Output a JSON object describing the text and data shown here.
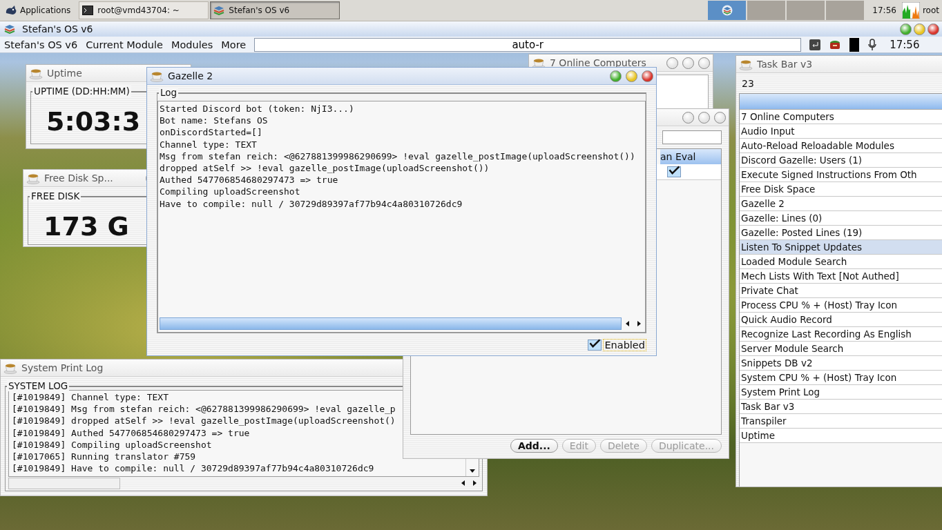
{
  "top_panel": {
    "apps_menu": "Applications",
    "tasks": [
      {
        "label": "root@vmd43704: ~",
        "kind": "terminal",
        "selected": false
      },
      {
        "label": "Stefan's OS v6",
        "kind": "app",
        "selected": true
      }
    ],
    "workspaces": [
      {
        "selected": true
      },
      {
        "selected": false
      },
      {
        "selected": false
      },
      {
        "selected": false
      }
    ],
    "clock": "17:56",
    "user": "root"
  },
  "os_window": {
    "title": "Stefan's OS v6",
    "focused": true,
    "menu": [
      "Stefan's OS v6",
      "Current Module",
      "Modules",
      "More"
    ],
    "command_field": {
      "value": "auto-r"
    },
    "clock": "17:56"
  },
  "uptime_window": {
    "title": "Uptime",
    "focused": false,
    "group": "UPTIME (DD:HH:MM)",
    "value": "5:03:3"
  },
  "disk_window": {
    "title": "Free Disk Sp...",
    "focused": false,
    "group": "FREE DISK",
    "value": "173 G"
  },
  "online_computers_window": {
    "title": "7 Online Computers",
    "focused": false
  },
  "modules_window": {
    "focused": false,
    "column": "an Eval",
    "rows": [
      {
        "checked": true
      }
    ],
    "buttons": [
      {
        "label": "Add...",
        "disabled": false
      },
      {
        "label": "Edit",
        "disabled": true
      },
      {
        "label": "Delete",
        "disabled": true
      },
      {
        "label": "Duplicate...",
        "disabled": true
      }
    ]
  },
  "gazelle_window": {
    "title": "Gazelle 2",
    "focused": true,
    "group": "Log",
    "lines": [
      "Started Discord bot (token: NjI3...)",
      "Bot name: Stefans OS",
      "onDiscordStarted=[]",
      "Channel type: TEXT",
      "Msg from stefan reich: <@627881399986290699> !eval gazelle_postImage(uploadScreenshot())",
      "dropped atSelf >> !eval gazelle_postImage(uploadScreenshot())",
      "Authed 547706854680297473 => true",
      "Compiling uploadScreenshot",
      "Have to compile: null / 30729d89397af77b94c4a80310726dc9"
    ],
    "enabled": {
      "label": "Enabled",
      "checked": true
    }
  },
  "system_log_window": {
    "title": "System Print Log",
    "focused": false,
    "group": "SYSTEM LOG",
    "lines": [
      "[#1019849] Channel type: TEXT",
      "[#1019849] Msg from stefan reich: <@627881399986290699> !eval gazelle_p",
      "[#1019849] dropped atSelf >> !eval gazelle_postImage(uploadScreenshot()",
      "[#1019849] Authed 547706854680297473 => true",
      "[#1019849] Compiling uploadScreenshot",
      "[#1017065] Running translator #759",
      "[#1019849] Have to compile: null / 30729d89397af77b94c4a80310726dc9"
    ]
  },
  "task_bar_window": {
    "title": "Task Bar v3",
    "focused": false,
    "count": "23",
    "items": [
      {
        "label": "7 Online Computers",
        "selected": false
      },
      {
        "label": "Audio Input",
        "selected": false
      },
      {
        "label": "Auto-Reload Reloadable Modules",
        "selected": false
      },
      {
        "label": "Discord Gazelle: Users (1)",
        "selected": false
      },
      {
        "label": "Execute Signed Instructions From Oth",
        "selected": false
      },
      {
        "label": "Free Disk Space",
        "selected": false
      },
      {
        "label": "Gazelle 2",
        "selected": false
      },
      {
        "label": "Gazelle: Lines (0)",
        "selected": false
      },
      {
        "label": "Gazelle: Posted Lines (19)",
        "selected": false
      },
      {
        "label": "Listen To Snippet Updates",
        "selected": true
      },
      {
        "label": "Loaded Module Search",
        "selected": false
      },
      {
        "label": "Mech Lists With Text [Not Authed]",
        "selected": false
      },
      {
        "label": "Private Chat",
        "selected": false
      },
      {
        "label": "Process CPU % + (Host) Tray Icon",
        "selected": false
      },
      {
        "label": "Quick Audio Record",
        "selected": false
      },
      {
        "label": "Recognize Last Recording As English",
        "selected": false
      },
      {
        "label": "Server Module Search",
        "selected": false
      },
      {
        "label": "Snippets DB v2",
        "selected": false
      },
      {
        "label": "System CPU % + (Host) Tray Icon",
        "selected": false
      },
      {
        "label": "System Print Log",
        "selected": false
      },
      {
        "label": "Task Bar v3",
        "selected": false
      },
      {
        "label": "Transpiler",
        "selected": false
      },
      {
        "label": "Uptime",
        "selected": false
      }
    ]
  }
}
